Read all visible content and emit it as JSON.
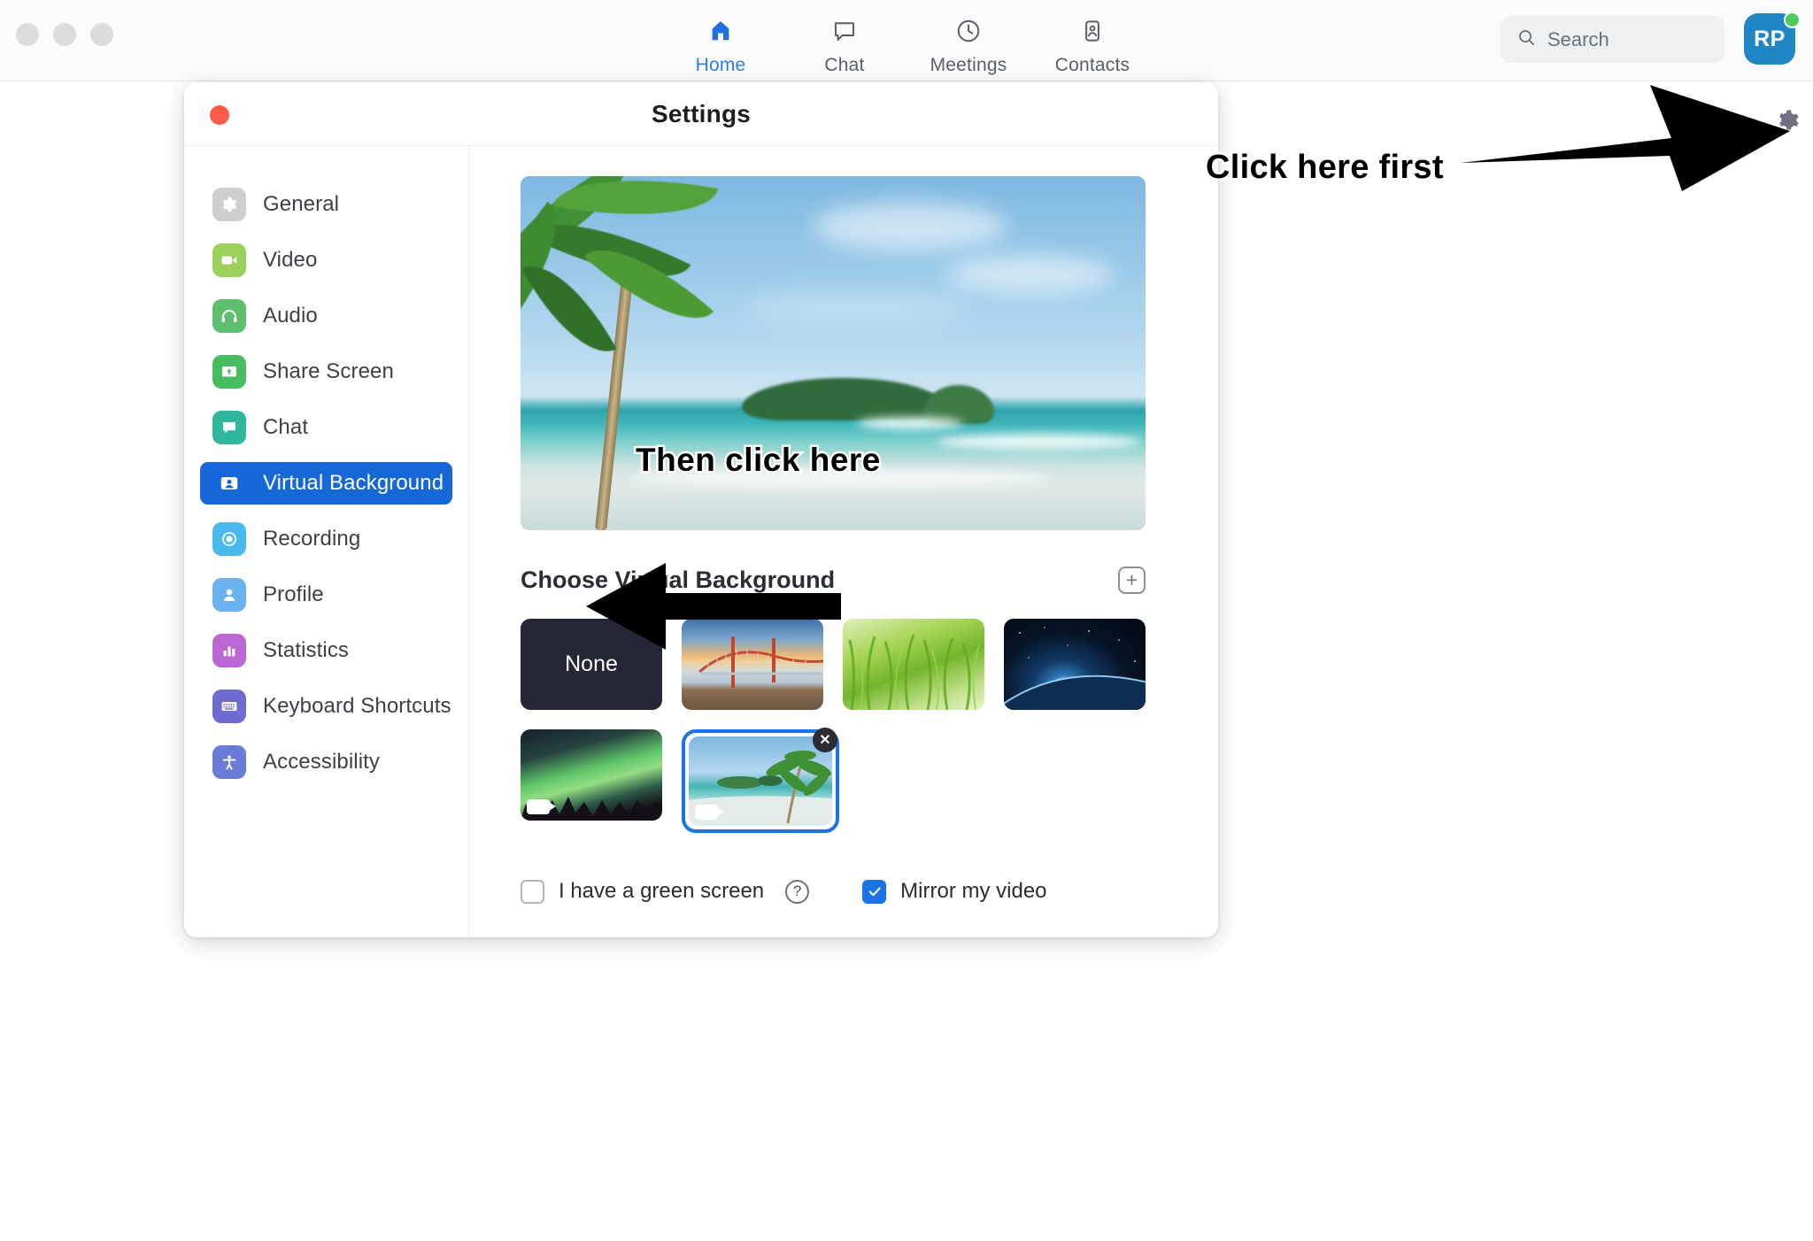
{
  "app": {
    "nav": [
      {
        "id": "home",
        "label": "Home",
        "icon": "home-icon",
        "active": true
      },
      {
        "id": "chat",
        "label": "Chat",
        "icon": "chat-bubble-icon",
        "active": false
      },
      {
        "id": "meetings",
        "label": "Meetings",
        "icon": "clock-icon",
        "active": false
      },
      {
        "id": "contacts",
        "label": "Contacts",
        "icon": "contacts-icon",
        "active": false
      }
    ],
    "search": {
      "placeholder": "Search",
      "value": "",
      "icon": "search-icon"
    },
    "avatar": {
      "initials": "RP",
      "status": "available",
      "color": "#2186c4"
    },
    "gear": {
      "icon": "gear-icon"
    },
    "accent_color": "#2b7de9"
  },
  "settings_window": {
    "title": "Settings",
    "close_button": "close-window-button",
    "sidebar": {
      "items": [
        {
          "label": "General",
          "icon": "gear-icon",
          "color": "#cfcfd1",
          "selected": false
        },
        {
          "label": "Video",
          "icon": "video-camera-icon",
          "color": "#9bd05a",
          "selected": false
        },
        {
          "label": "Audio",
          "icon": "headphones-icon",
          "color": "#5cc06e",
          "selected": false
        },
        {
          "label": "Share Screen",
          "icon": "share-screen-icon",
          "color": "#48bd5f",
          "selected": false
        },
        {
          "label": "Chat",
          "icon": "chat-bubble-icon",
          "color": "#2fb79b",
          "selected": false
        },
        {
          "label": "Virtual Background",
          "icon": "person-card-icon",
          "color": "#1668d9",
          "selected": true
        },
        {
          "label": "Recording",
          "icon": "record-circle-icon",
          "color": "#49b9ee",
          "selected": false
        },
        {
          "label": "Profile",
          "icon": "person-icon",
          "color": "#6bb3f0",
          "selected": false
        },
        {
          "label": "Statistics",
          "icon": "bar-chart-icon",
          "color": "#bb68d4",
          "selected": false
        },
        {
          "label": "Keyboard Shortcuts",
          "icon": "keyboard-icon",
          "color": "#6f6cd1",
          "selected": false
        },
        {
          "label": "Accessibility",
          "icon": "accessibility-icon",
          "color": "#6a7cd8",
          "selected": false
        }
      ]
    },
    "main": {
      "preview": {
        "name": "video-preview",
        "description": "tropical beach with palm tree"
      },
      "choose_title": "Choose Virtual Background",
      "add_button": {
        "label": "+",
        "name": "add-background-button"
      },
      "backgrounds": [
        {
          "id": "none",
          "label": "None",
          "art": "none",
          "selected": false,
          "video": false,
          "removable": false
        },
        {
          "id": "bridge",
          "label": "",
          "art": "bridge",
          "selected": false,
          "video": false,
          "removable": false
        },
        {
          "id": "grass",
          "label": "",
          "art": "grass",
          "selected": false,
          "video": false,
          "removable": false
        },
        {
          "id": "space",
          "label": "",
          "art": "space",
          "selected": false,
          "video": false,
          "removable": false
        },
        {
          "id": "aurora",
          "label": "",
          "art": "aurora",
          "selected": false,
          "video": true,
          "removable": false
        },
        {
          "id": "beach",
          "label": "",
          "art": "beach",
          "selected": true,
          "video": true,
          "removable": true
        }
      ],
      "options": [
        {
          "id": "green-screen",
          "label": "I have a green screen",
          "checked": false,
          "help": "?"
        },
        {
          "id": "mirror-video",
          "label": "Mirror my video",
          "checked": true,
          "help": ""
        }
      ]
    }
  },
  "annotations": [
    {
      "id": "step-1",
      "text": "Click here first",
      "points_to": "gear-icon"
    },
    {
      "id": "step-2",
      "text": "Then click here",
      "points_to": "sidebar-item-virtual-background"
    }
  ]
}
